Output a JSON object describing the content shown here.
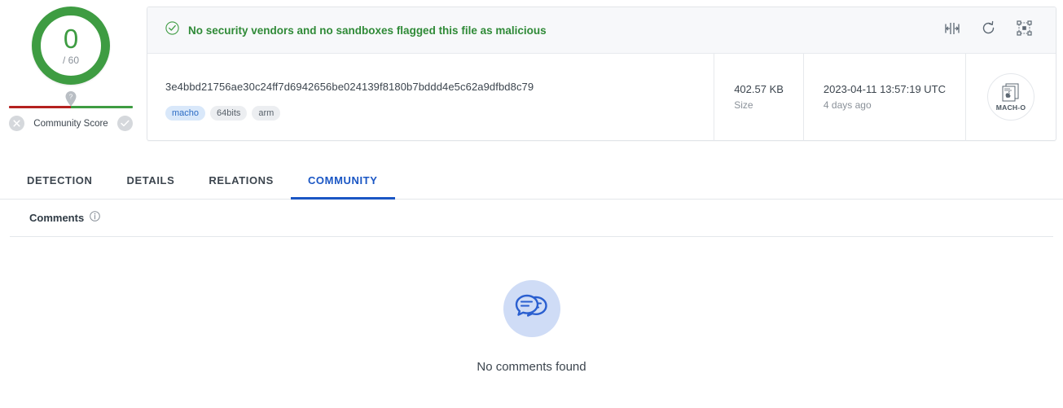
{
  "score": {
    "value": "0",
    "total": "/ 60",
    "ring_color": "#3e9c42",
    "community_label": "Community Score",
    "pin_icon": "question-pin-icon",
    "negative_icon": "x-circle-icon",
    "positive_icon": "check-circle-icon",
    "bar_red": "#b5211f",
    "bar_green": "#3e9c42"
  },
  "banner": {
    "status_text": "No security vendors and no sandboxes flagged this file as malicious",
    "status_color": "#2f8a37",
    "check_icon": "check-circle-icon",
    "actions": [
      {
        "icon": "similar-files-icon",
        "name": "similar-files-button"
      },
      {
        "icon": "reanalyze-icon",
        "name": "reanalyze-button"
      },
      {
        "icon": "graph-pivot-icon",
        "name": "graph-button"
      }
    ]
  },
  "file": {
    "hash": "3e4bbd21756ae30c24ff7d6942656be024139f8180b7bddd4e5c62a9dfbd8c79",
    "tags": [
      {
        "label": "macho",
        "style": "blue"
      },
      {
        "label": "64bits",
        "style": "gray"
      },
      {
        "label": "arm",
        "style": "gray"
      }
    ],
    "size_value": "402.57 KB",
    "size_label": "Size",
    "date_value": "2023-04-11 13:57:19 UTC",
    "date_relative": "4 days ago",
    "type_label": "MACH-O",
    "type_icon": "macho-file-icon"
  },
  "tabs": [
    {
      "label": "DETECTION",
      "active": false
    },
    {
      "label": "DETAILS",
      "active": false
    },
    {
      "label": "RELATIONS",
      "active": false
    },
    {
      "label": "COMMUNITY",
      "active": true
    }
  ],
  "comments": {
    "title": "Comments",
    "info_icon": "info-icon",
    "empty_icon": "speech-bubbles-icon",
    "empty_text": "No comments found"
  }
}
